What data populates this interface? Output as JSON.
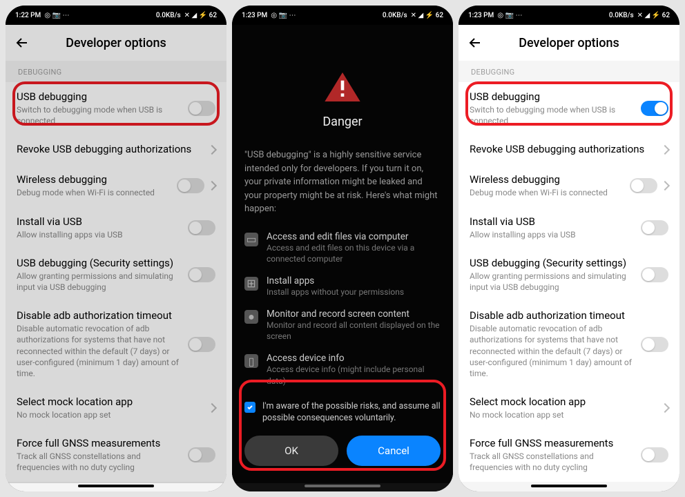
{
  "status1": {
    "time": "1:22 PM",
    "net": "0.0KB/s"
  },
  "status2": {
    "time": "1:23 PM",
    "net": "0.0KB/s"
  },
  "status3": {
    "time": "1:23 PM",
    "net": "0.0KB/s"
  },
  "header": {
    "title": "Developer options"
  },
  "section": "DEBUGGING",
  "settings": {
    "usb_debugging": {
      "name": "USB debugging",
      "sub": "Switch to debugging mode when USB is connected"
    },
    "revoke": {
      "name": "Revoke USB debugging authorizations"
    },
    "wireless": {
      "name": "Wireless debugging",
      "sub": "Debug mode when Wi-Fi is connected"
    },
    "install_usb": {
      "name": "Install via USB",
      "sub": "Allow installing apps via USB"
    },
    "security": {
      "name": "USB debugging (Security settings)",
      "sub": "Allow granting permissions and simulating input via USB debugging"
    },
    "adb_timeout": {
      "name": "Disable adb authorization timeout",
      "sub": "Disable automatic revocation of adb authorizations for systems that have not reconnected within the default (7 days) or user-configured (minimum 1 day) amount of time."
    },
    "mock_location": {
      "name": "Select mock location app",
      "sub": "No mock location app set"
    },
    "gnss": {
      "name": "Force full GNSS measurements",
      "sub": "Track all GNSS constellations and frequencies with no duty cycling"
    }
  },
  "dialog": {
    "title": "Danger",
    "body": "\"USB debugging\" is a highly sensitive service intended only for developers. If you turn it on, your private information might be leaked and your property might be at risk. Here's what might happen:",
    "risks": {
      "files": {
        "title": "Access and edit files via computer",
        "sub": "Access and edit files on this device via a connected computer"
      },
      "apps": {
        "title": "Install apps",
        "sub": "Install apps without your permissions"
      },
      "screen": {
        "title": "Monitor and record screen content",
        "sub": "Monitor and record all content displayed on the screen"
      },
      "device": {
        "title": "Access device info",
        "sub": "Access device info (might include personal data)"
      }
    },
    "agree": "I'm aware of the possible risks, and assume all possible consequences voluntarily.",
    "ok": "OK",
    "cancel": "Cancel"
  }
}
